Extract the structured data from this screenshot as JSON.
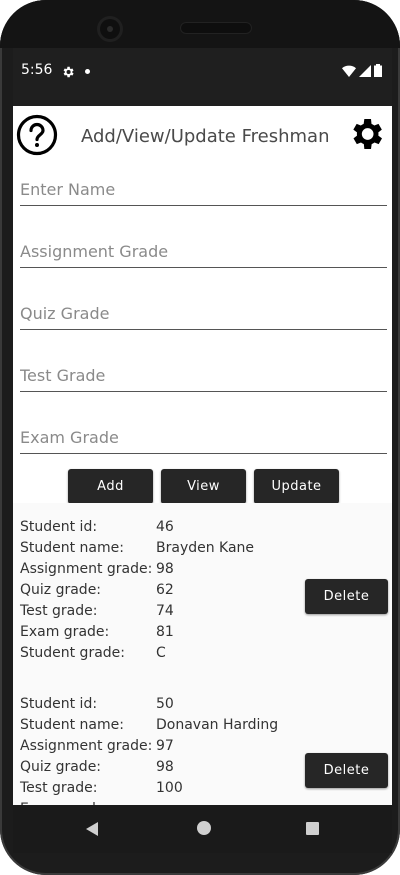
{
  "status": {
    "time": "5:56"
  },
  "header": {
    "title": "Add/View/Update Freshman"
  },
  "form": {
    "name_placeholder": "Enter Name",
    "assignment_placeholder": "Assignment Grade",
    "quiz_placeholder": "Quiz Grade",
    "test_placeholder": "Test Grade",
    "exam_placeholder": "Exam Grade"
  },
  "actions": {
    "add": "Add",
    "view": "View",
    "update": "Update"
  },
  "labels": {
    "id": "Student id:",
    "name": "Student name:",
    "assignment": "Assignment grade:",
    "quiz": "Quiz grade:",
    "test": "Test grade:",
    "exam": "Exam grade:",
    "grade": "Student grade:",
    "delete": "Delete"
  },
  "records": [
    {
      "id": "46",
      "name": "Brayden Kane",
      "assignment": "98",
      "quiz": "62",
      "test": "74",
      "exam": "81",
      "grade": "C"
    },
    {
      "id": "50",
      "name": "Donavan Harding",
      "assignment": "97",
      "quiz": "98",
      "test": "100"
    }
  ],
  "colors": {
    "button_bg": "#262626",
    "status_bar": "#1f1f1f",
    "accent_text": "#4a4a4a"
  }
}
